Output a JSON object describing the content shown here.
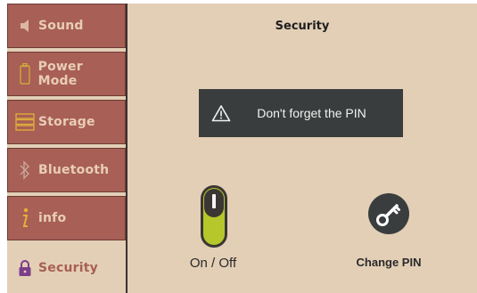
{
  "sidebar": {
    "items": [
      {
        "label": "Sound",
        "icon": "speaker-icon"
      },
      {
        "label": "Power Mode",
        "icon": "battery-icon"
      },
      {
        "label": "Storage",
        "icon": "storage-icon"
      },
      {
        "label": "Bluetooth",
        "icon": "bluetooth-icon"
      },
      {
        "label": "info",
        "icon": "info-icon"
      },
      {
        "label": "Security",
        "icon": "lock-icon",
        "active": true
      }
    ]
  },
  "main": {
    "title": "Security",
    "toast": {
      "icon": "warning-icon",
      "text": "Don't forget the PIN"
    },
    "toggle": {
      "label": "On / Off",
      "state": "on"
    },
    "change_pin": {
      "icon": "key-icon",
      "label": "Change PIN"
    }
  },
  "colors": {
    "background": "#e3cfb6",
    "nav_item": "#a85f55",
    "nav_text": "#e8cdb8",
    "accent_green": "#b5c72a",
    "toast_bg": "#3a3d3d",
    "dark": "#3c3230"
  }
}
